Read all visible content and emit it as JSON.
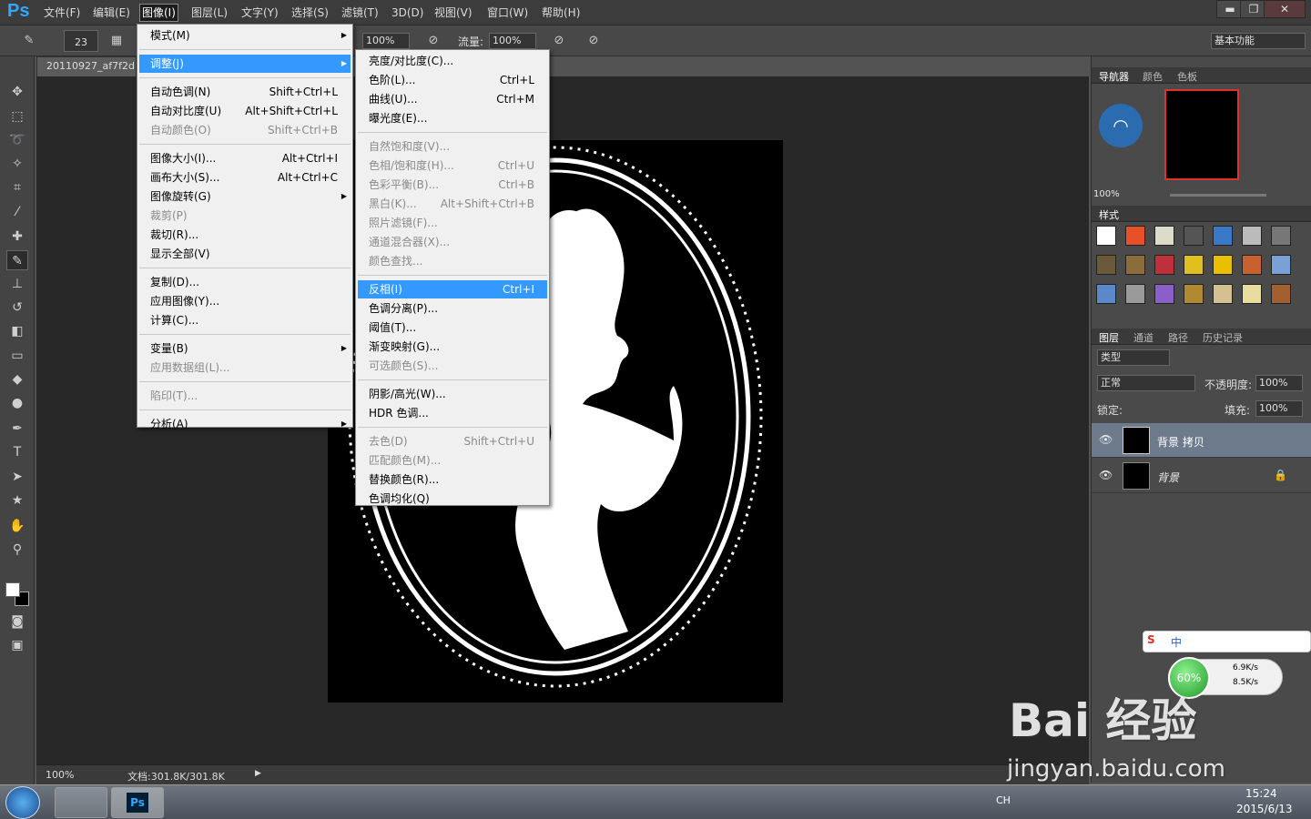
{
  "app": {
    "logo": "Ps"
  },
  "menubar": {
    "items": [
      "文件(F)",
      "编辑(E)",
      "图像(I)",
      "图层(L)",
      "文字(Y)",
      "选择(S)",
      "滤镜(T)",
      "3D(D)",
      "视图(V)",
      "窗口(W)",
      "帮助(H)"
    ]
  },
  "window_buttons": {
    "minimize": "▬",
    "restore": "❐",
    "close": "✕"
  },
  "options": {
    "brush_size": "23",
    "opacity_value": "100%",
    "flow_label": "流量:",
    "flow_value": "100%",
    "workspace": "基本功能"
  },
  "document": {
    "tab_title": "20110927_af7f2d",
    "zoom": "100%",
    "doc_size": "文档:301.8K/301.8K"
  },
  "image_menu": {
    "items": [
      {
        "label": "模式(M)",
        "shortcut": "",
        "submenu": true,
        "disabled": false
      },
      {
        "label": "调整(J)",
        "shortcut": "",
        "submenu": true,
        "disabled": false,
        "highlighted": true
      },
      {
        "label": "自动色调(N)",
        "shortcut": "Shift+Ctrl+L",
        "disabled": false
      },
      {
        "label": "自动对比度(U)",
        "shortcut": "Alt+Shift+Ctrl+L",
        "disabled": false
      },
      {
        "label": "自动颜色(O)",
        "shortcut": "Shift+Ctrl+B",
        "disabled": true
      },
      {
        "label": "图像大小(I)...",
        "shortcut": "Alt+Ctrl+I",
        "disabled": false
      },
      {
        "label": "画布大小(S)...",
        "shortcut": "Alt+Ctrl+C",
        "disabled": false
      },
      {
        "label": "图像旋转(G)",
        "shortcut": "",
        "submenu": true,
        "disabled": false
      },
      {
        "label": "裁剪(P)",
        "shortcut": "",
        "disabled": true
      },
      {
        "label": "裁切(R)...",
        "shortcut": "",
        "disabled": false
      },
      {
        "label": "显示全部(V)",
        "shortcut": "",
        "disabled": false
      },
      {
        "label": "复制(D)...",
        "shortcut": "",
        "disabled": false
      },
      {
        "label": "应用图像(Y)...",
        "shortcut": "",
        "disabled": false
      },
      {
        "label": "计算(C)...",
        "shortcut": "",
        "disabled": false
      },
      {
        "label": "变量(B)",
        "shortcut": "",
        "submenu": true,
        "disabled": false
      },
      {
        "label": "应用数据组(L)...",
        "shortcut": "",
        "disabled": true
      },
      {
        "label": "陷印(T)...",
        "shortcut": "",
        "disabled": true
      },
      {
        "label": "分析(A)",
        "shortcut": "",
        "submenu": true,
        "disabled": false
      }
    ]
  },
  "adjust_menu": {
    "items": [
      {
        "label": "亮度/对比度(C)...",
        "shortcut": "",
        "disabled": false
      },
      {
        "label": "色阶(L)...",
        "shortcut": "Ctrl+L",
        "disabled": false
      },
      {
        "label": "曲线(U)...",
        "shortcut": "Ctrl+M",
        "disabled": false
      },
      {
        "label": "曝光度(E)...",
        "shortcut": "",
        "disabled": false
      },
      {
        "label": "自然饱和度(V)...",
        "shortcut": "",
        "disabled": true
      },
      {
        "label": "色相/饱和度(H)...",
        "shortcut": "Ctrl+U",
        "disabled": true
      },
      {
        "label": "色彩平衡(B)...",
        "shortcut": "Ctrl+B",
        "disabled": true
      },
      {
        "label": "黑白(K)...",
        "shortcut": "Alt+Shift+Ctrl+B",
        "disabled": true
      },
      {
        "label": "照片滤镜(F)...",
        "shortcut": "",
        "disabled": true
      },
      {
        "label": "通道混合器(X)...",
        "shortcut": "",
        "disabled": true
      },
      {
        "label": "颜色查找...",
        "shortcut": "",
        "disabled": true
      },
      {
        "label": "反相(I)",
        "shortcut": "Ctrl+I",
        "disabled": false,
        "highlighted": true
      },
      {
        "label": "色调分离(P)...",
        "shortcut": "",
        "disabled": false
      },
      {
        "label": "阈值(T)...",
        "shortcut": "",
        "disabled": false
      },
      {
        "label": "渐变映射(G)...",
        "shortcut": "",
        "disabled": false
      },
      {
        "label": "可选颜色(S)...",
        "shortcut": "",
        "disabled": true
      },
      {
        "label": "阴影/高光(W)...",
        "shortcut": "",
        "disabled": false
      },
      {
        "label": "HDR 色调...",
        "shortcut": "",
        "disabled": false
      },
      {
        "label": "去色(D)",
        "shortcut": "Shift+Ctrl+U",
        "disabled": true
      },
      {
        "label": "匹配颜色(M)...",
        "shortcut": "",
        "disabled": true
      },
      {
        "label": "替换颜色(R)...",
        "shortcut": "",
        "disabled": false
      },
      {
        "label": "色调均化(Q)",
        "shortcut": "",
        "disabled": false
      }
    ]
  },
  "panels": {
    "navigator_tabs": [
      "导航器",
      "颜色",
      "色板"
    ],
    "navigator_zoom": "100%",
    "styles_tab": "样式",
    "layers_tabs": [
      "图层",
      "通道",
      "路径",
      "历史记录"
    ],
    "layer_filter": "类型",
    "blend_mode": "正常",
    "opacity_label": "不透明度:",
    "opacity_value": "100%",
    "lock_label": "锁定:",
    "fill_label": "填充:",
    "fill_value": "100%",
    "layers": [
      {
        "name": "背景 拷贝",
        "selected": true
      },
      {
        "name": "背景",
        "selected": false,
        "locked": true
      }
    ],
    "style_colors": [
      "#ffffff",
      "#e8502a",
      "#dcdcc8",
      "#555555",
      "#3a78c8",
      "#bbbbbb",
      "#777777",
      "#6b5a3a",
      "#8a6d3b",
      "#c0303a",
      "#e0c020",
      "#e8c000",
      "#c86030",
      "#7aa0d8",
      "#5a88c8",
      "#9a9a9a",
      "#8a60c8",
      "#b08a30",
      "#d4c090",
      "#e8dca0",
      "#a06030"
    ]
  },
  "overlays": {
    "ime_label": "中",
    "net_percent": "60%",
    "net_up": "6.9K/s",
    "net_down": "8.5K/s",
    "watermark": "Bai 经验",
    "watermark_url": "jingyan.baidu.com"
  },
  "taskbar": {
    "lang": "CH",
    "time": "15:24",
    "date": "2015/6/13"
  }
}
